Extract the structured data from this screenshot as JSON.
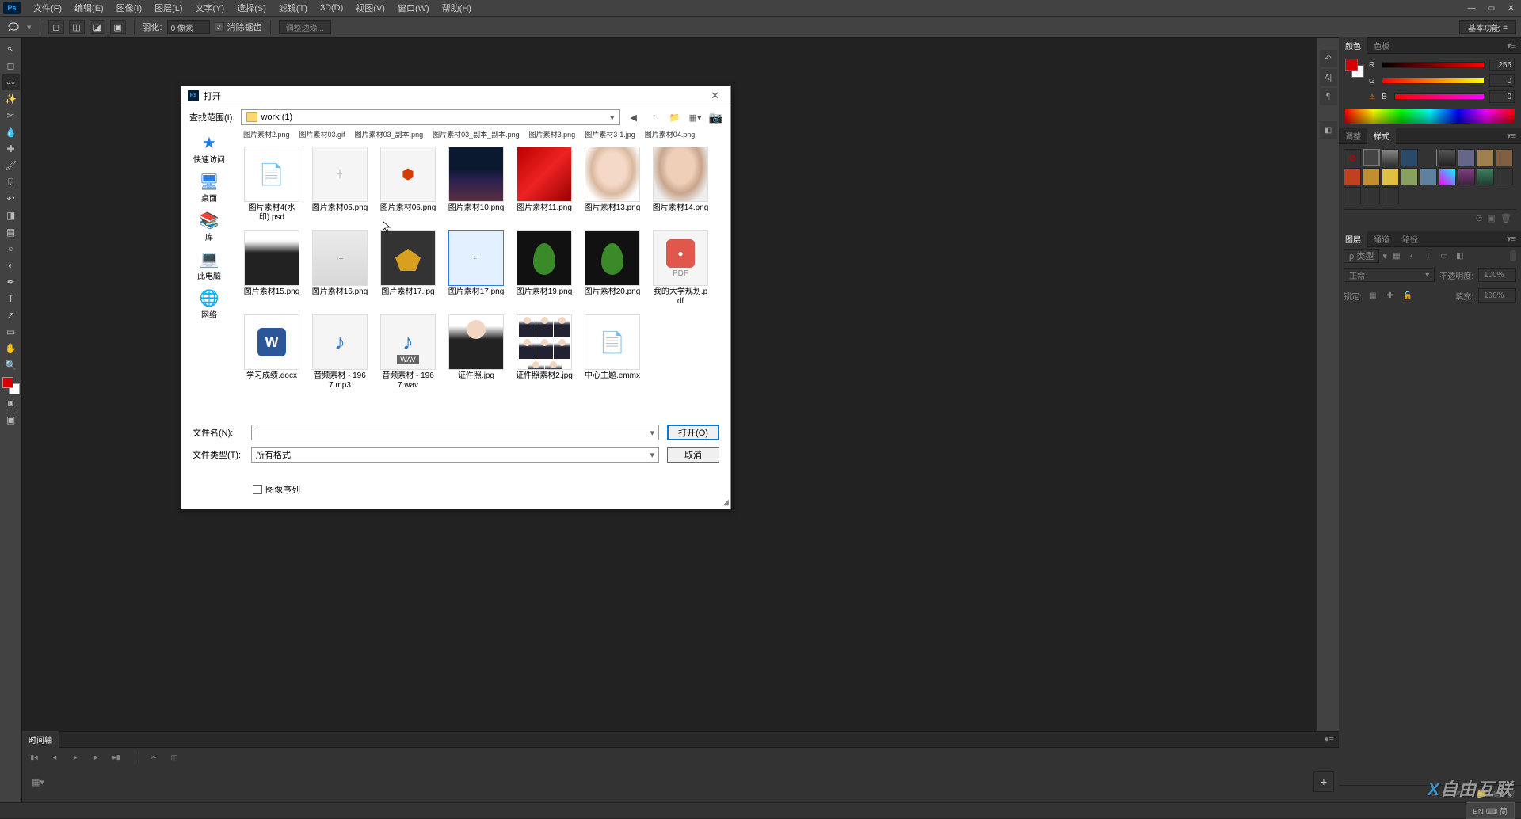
{
  "menubar": {
    "items": [
      "文件(F)",
      "编辑(E)",
      "图像(I)",
      "图层(L)",
      "文字(Y)",
      "选择(S)",
      "滤镜(T)",
      "3D(D)",
      "视图(V)",
      "窗口(W)",
      "帮助(H)"
    ]
  },
  "options": {
    "feather_label": "羽化:",
    "feather_value": "0 像素",
    "antialias_label": "消除锯齿",
    "refine_label": "调整边缘...",
    "workspace": "基本功能"
  },
  "panels": {
    "color_tab": "颜色",
    "swatches_tab": "色板",
    "r_label": "R",
    "g_label": "G",
    "b_label": "B",
    "r_val": "255",
    "g_val": "0",
    "b_val": "0",
    "adjust_tab": "调整",
    "styles_tab": "样式",
    "layers_tab": "图层",
    "channels_tab": "通道",
    "paths_tab": "路径",
    "filter_label": "ρ 类型",
    "blend_mode": "正常",
    "opacity_label": "不透明度:",
    "opacity_val": "100%",
    "lock_label": "锁定:",
    "fill_label": "填充:",
    "fill_val": "100%"
  },
  "timeline": {
    "tab": "时间轴"
  },
  "dialog": {
    "title": "打开",
    "range_label": "查找范围(I):",
    "folder": "work (1)",
    "name_label": "文件名(N):",
    "name_value": "",
    "type_label": "文件类型(T):",
    "type_value": "所有格式",
    "open_btn": "打开(O)",
    "cancel_btn": "取消",
    "seq_label": "图像序列",
    "sidebar": [
      {
        "icon": "star",
        "label": "快速访问",
        "color": "#2a7de1"
      },
      {
        "icon": "desktop",
        "label": "桌面",
        "color": "#2a7de1"
      },
      {
        "icon": "lib",
        "label": "库",
        "color": "#d9a020"
      },
      {
        "icon": "pc",
        "label": "此电脑",
        "color": "#2a7de1"
      },
      {
        "icon": "net",
        "label": "网络",
        "color": "#2a7de1"
      }
    ],
    "partial_row": [
      "图片素材2.png",
      "图片素材03.gif",
      "图片素材03_副本.png",
      "图片素材03_副本_副本.png",
      "图片素材3.png",
      "图片素材3-1.jpg",
      "图片素材04.png"
    ],
    "files": [
      {
        "label": "图片素材4(水印).psd",
        "thumb": "psd"
      },
      {
        "label": "图片素材05.png",
        "thumb": "blank"
      },
      {
        "label": "图片素材06.png",
        "thumb": "office"
      },
      {
        "label": "图片素材10.png",
        "thumb": "city"
      },
      {
        "label": "图片素材11.png",
        "thumb": "red"
      },
      {
        "label": "图片素材13.png",
        "thumb": "face1"
      },
      {
        "label": "图片素材14.png",
        "thumb": "face2"
      },
      {
        "label": "图片素材15.png",
        "thumb": "suit"
      },
      {
        "label": "图片素材16.png",
        "thumb": "note"
      },
      {
        "label": "图片素材17.jpg",
        "thumb": "leafy"
      },
      {
        "label": "图片素材17.png",
        "thumb": "pale",
        "selected": true
      },
      {
        "label": "图片素材19.png",
        "thumb": "leafg"
      },
      {
        "label": "图片素材20.png",
        "thumb": "leafg2"
      },
      {
        "label": "我的大学规划.pdf",
        "thumb": "pdf"
      },
      {
        "label": "学习成绩.docx",
        "thumb": "docx"
      },
      {
        "label": "音频素材 - 1967.mp3",
        "thumb": "mp3"
      },
      {
        "label": "音频素材 - 1967.wav",
        "thumb": "wav"
      },
      {
        "label": "证件照.jpg",
        "thumb": "id"
      },
      {
        "label": "证件照素材2.jpg",
        "thumb": "idgrid"
      },
      {
        "label": "中心主题.emmx",
        "thumb": "blankfile"
      }
    ]
  },
  "taskbar": {
    "ime": "EN ⌨ 简"
  },
  "watermark": "自由互联"
}
